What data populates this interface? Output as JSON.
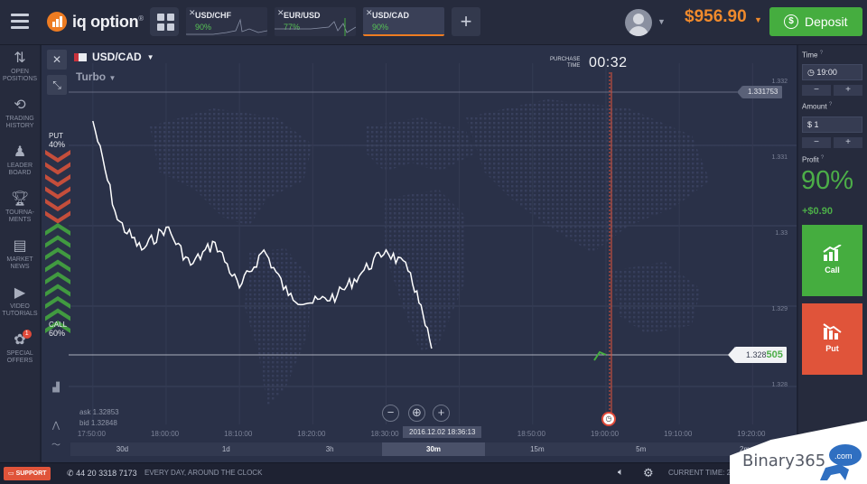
{
  "topbar": {
    "logo_text": "iq option",
    "logo_reg": "®",
    "tabs": [
      {
        "name": "USD/CHF",
        "payout": "90%"
      },
      {
        "name": "EUR/USD",
        "payout": "77%"
      },
      {
        "name": "USD/CAD",
        "payout": "90%"
      }
    ],
    "add_tab": "+",
    "balance": "$956.90",
    "deposit_label": "Deposit"
  },
  "sidebar": {
    "items": [
      {
        "label": "OPEN POSITIONS",
        "icon": "sort-arrows-icon"
      },
      {
        "label": "TRADING HISTORY",
        "icon": "history-icon"
      },
      {
        "label": "LEADER BOARD",
        "icon": "leaderboard-icon"
      },
      {
        "label": "TOURNA-MENTS",
        "icon": "trophy-icon"
      },
      {
        "label": "MARKET NEWS",
        "icon": "news-icon"
      },
      {
        "label": "VIDEO TUTORIALS",
        "icon": "play-icon"
      },
      {
        "label": "SPECIAL OFFERS",
        "icon": "offers-icon",
        "badge": "1"
      }
    ]
  },
  "chart": {
    "pair": "USD/CAD",
    "mode": "Turbo",
    "purchase_label_1": "PURCHASE",
    "purchase_label_2": "TIME",
    "purchase_time": "00:32",
    "high_tag": "1.331753",
    "current_tag_main": "1.328",
    "current_tag_end": "505",
    "put_label": "PUT",
    "put_pct": "40%",
    "call_label": "CALL",
    "call_pct": "60%",
    "ask": "ask 1.32853",
    "bid": "bid 1.32848",
    "timestamp": "2016.12.02 18:36:13",
    "timeframes": [
      "30d",
      "1d",
      "3h",
      "30m",
      "15m",
      "5m",
      "2m"
    ],
    "active_timeframe": "30m",
    "colors": {
      "put": "#e0543a",
      "call": "#45ad3f",
      "line": "#ffffff"
    }
  },
  "chart_data": {
    "type": "line",
    "x": [
      "17:50:00",
      "17:53:20",
      "17:56:40",
      "18:00:00",
      "18:03:20",
      "18:06:40",
      "18:10:00",
      "18:13:20",
      "18:16:40",
      "18:20:00",
      "18:23:20",
      "18:26:40",
      "18:30:00",
      "18:33:20",
      "18:36:13"
    ],
    "y": [
      1.3315,
      1.3302,
      1.3298,
      1.3301,
      1.3296,
      1.3299,
      1.3293,
      1.3298,
      1.3292,
      1.3291,
      1.3292,
      1.3295,
      1.3298,
      1.3295,
      1.3285
    ],
    "ylim": [
      1.3275,
      1.3325
    ],
    "yticks": [
      "1.332",
      "1.331",
      "1.33",
      "1.329",
      "1.328"
    ],
    "xticks": [
      "17:50:00",
      "18:00:00",
      "18:10:00",
      "18:20:00",
      "18:30:00",
      "18:40:00",
      "18:50:00",
      "19:00:00",
      "19:10:00",
      "19:20:00"
    ],
    "xlim": [
      "17:43:00",
      "19:26:00"
    ],
    "expiry_time": "19:00:00",
    "grid": true
  },
  "rpanel": {
    "time_label": "Time",
    "time_value": "19:00",
    "amount_label": "Amount",
    "amount_value": "$ 1",
    "minus": "−",
    "plus": "+",
    "profit_label": "Profit",
    "profit_pct": "90%",
    "profit_amount": "+$0.90",
    "call_label": "Call",
    "put_label": "Put"
  },
  "statusbar": {
    "support": "SUPPORT",
    "phone": "44 20 3318 7173",
    "hours": "EVERY DAY, AROUND THE CLOCK",
    "current_time": "CURRENT TIME: 2 DECEMBER, 18:36:13"
  },
  "watermark": {
    "text": "Binary365",
    "badge": ".com"
  }
}
